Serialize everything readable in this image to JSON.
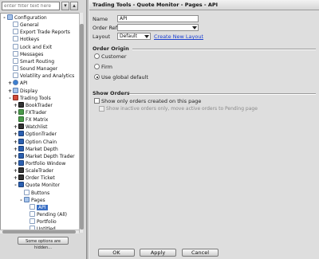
{
  "filter": {
    "placeholder": "enter filter text here"
  },
  "tree": [
    {
      "label": "Configuration",
      "icon": "folder",
      "indent": 0,
      "toggle": "-"
    },
    {
      "label": "General",
      "icon": "page",
      "indent": 1,
      "toggle": ""
    },
    {
      "label": "Export Trade Reports",
      "icon": "page",
      "indent": 1,
      "toggle": ""
    },
    {
      "label": "Hotkeys",
      "icon": "page",
      "indent": 1,
      "toggle": ""
    },
    {
      "label": "Lock and Exit",
      "icon": "page",
      "indent": 1,
      "toggle": ""
    },
    {
      "label": "Messages",
      "icon": "page",
      "indent": 1,
      "toggle": ""
    },
    {
      "label": "Smart Routing",
      "icon": "page",
      "indent": 1,
      "toggle": ""
    },
    {
      "label": "Sound Manager",
      "icon": "page",
      "indent": 1,
      "toggle": ""
    },
    {
      "label": "Volatility and Analytics",
      "icon": "page",
      "indent": 1,
      "toggle": ""
    },
    {
      "label": "API",
      "icon": "gear",
      "indent": 1,
      "toggle": "+"
    },
    {
      "label": "Display",
      "icon": "folder",
      "indent": 1,
      "toggle": "+"
    },
    {
      "label": "Trading Tools",
      "icon": "red",
      "indent": 1,
      "toggle": "-"
    },
    {
      "label": "BookTrader",
      "icon": "dark",
      "indent": 2,
      "toggle": "+"
    },
    {
      "label": "FXTrader",
      "icon": "chart",
      "indent": 2,
      "toggle": "+"
    },
    {
      "label": "FX Matrix",
      "icon": "chart",
      "indent": 2,
      "toggle": ""
    },
    {
      "label": "Watchlist",
      "icon": "dark",
      "indent": 2,
      "toggle": "+"
    },
    {
      "label": "OptionTrader",
      "icon": "blue",
      "indent": 2,
      "toggle": "+"
    },
    {
      "label": "Option Chain",
      "icon": "blue",
      "indent": 2,
      "toggle": "+"
    },
    {
      "label": "Market Depth",
      "icon": "blue",
      "indent": 2,
      "toggle": "+"
    },
    {
      "label": "Market Depth Trader",
      "icon": "blue",
      "indent": 2,
      "toggle": "+"
    },
    {
      "label": "Portfolio Window",
      "icon": "blue",
      "indent": 2,
      "toggle": "+"
    },
    {
      "label": "ScaleTrader",
      "icon": "dark",
      "indent": 2,
      "toggle": "+"
    },
    {
      "label": "Order Ticket",
      "icon": "dark",
      "indent": 2,
      "toggle": "+"
    },
    {
      "label": "Quote Monitor",
      "icon": "blue",
      "indent": 2,
      "toggle": "-"
    },
    {
      "label": "Buttons",
      "icon": "page",
      "indent": 3,
      "toggle": ""
    },
    {
      "label": "Pages",
      "icon": "folder",
      "indent": 3,
      "toggle": "-"
    },
    {
      "label": "API",
      "icon": "page",
      "indent": 4,
      "toggle": "",
      "selected": true
    },
    {
      "label": "Pending (All)",
      "icon": "page",
      "indent": 4,
      "toggle": ""
    },
    {
      "label": "Portfolio",
      "icon": "page",
      "indent": 4,
      "toggle": ""
    },
    {
      "label": "Untitled",
      "icon": "page",
      "indent": 4,
      "toggle": ""
    }
  ],
  "hidden_button": "Some options are hidden...",
  "header": {
    "title": "Trading Tools - Quote Monitor - Pages - API"
  },
  "form": {
    "name_label": "Name",
    "name_value": "API",
    "order_ref_label": "Order Ref",
    "order_ref_value": "",
    "layout_label": "Layout",
    "layout_value": "Default",
    "create_layout": "Create New Layout"
  },
  "order_origin": {
    "title": "Order Origin",
    "options": [
      "Customer",
      "Firm",
      "Use global default"
    ],
    "selected": 2
  },
  "show_orders": {
    "title": "Show Orders",
    "only_created": "Show only orders created on this page",
    "only_created_checked": false,
    "show_inactive": "Show inactive orders only, move active orders to Pending page",
    "show_inactive_checked": false,
    "show_inactive_enabled": false
  },
  "buttons": {
    "ok": "OK",
    "apply": "Apply",
    "cancel": "Cancel"
  }
}
